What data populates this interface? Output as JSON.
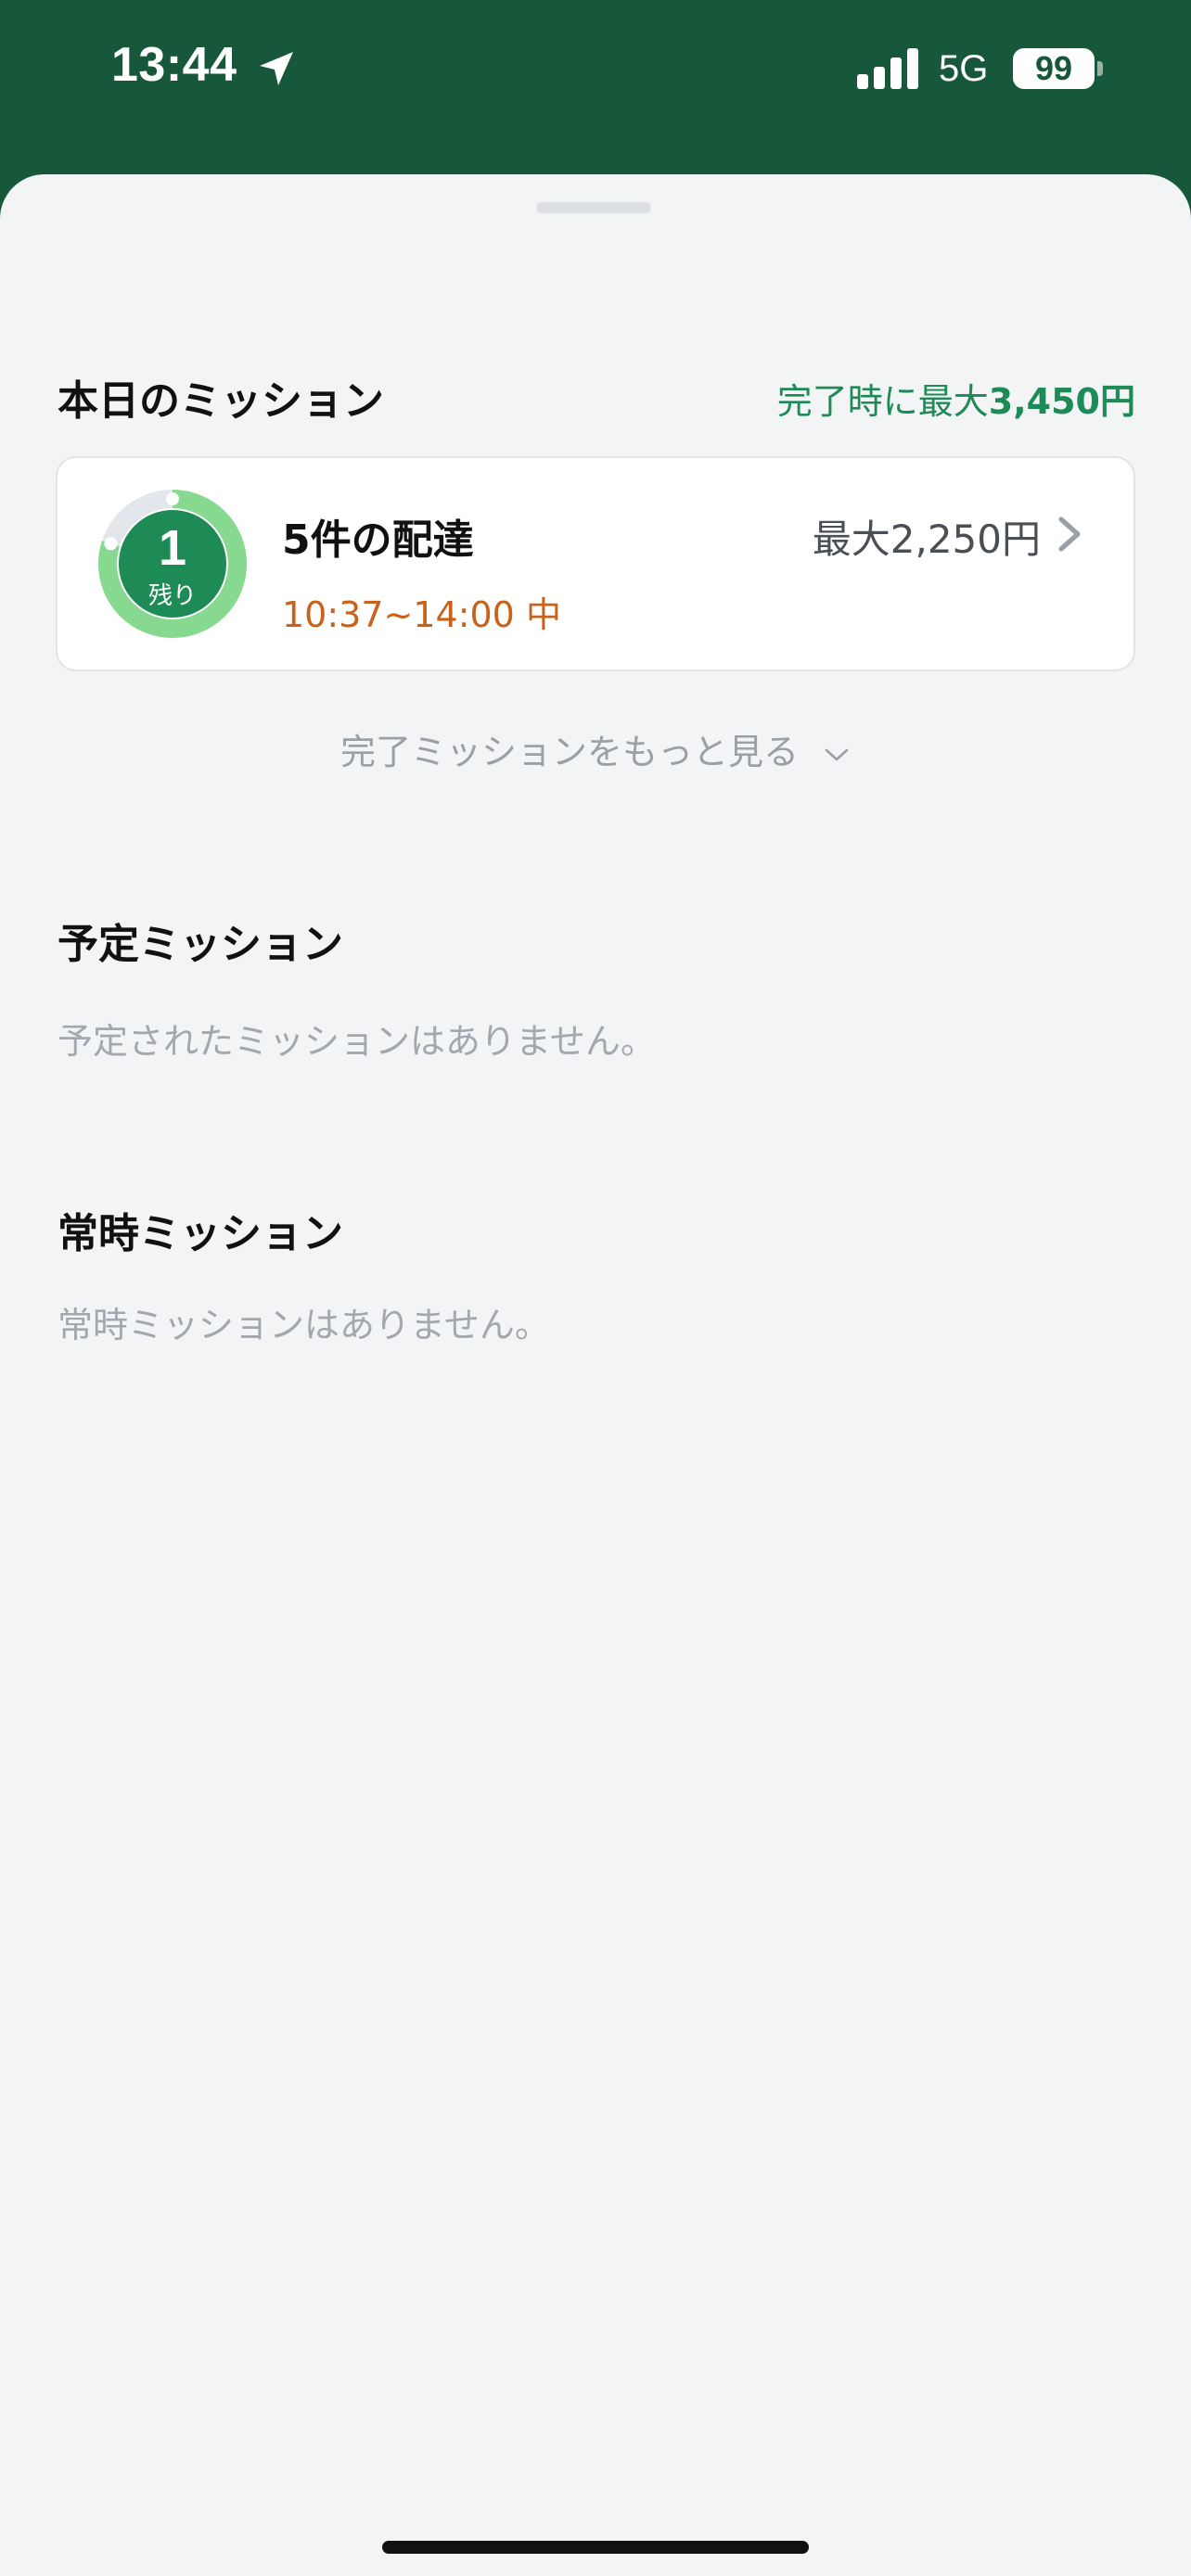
{
  "status_bar": {
    "time": "13:44",
    "network": "5G",
    "battery": "99",
    "icons": [
      "location-arrow-icon",
      "signal-icon",
      "battery-icon"
    ]
  },
  "today": {
    "title": "本日のミッション",
    "reward_prefix": "完了時に最大",
    "reward_amount": "3,450円",
    "reward_color": "#1e8a55",
    "mission": {
      "remaining_number": "1",
      "remaining_label": "残り",
      "title": "5件の配達",
      "time": "10:37~14:00 中",
      "reward": "最大2,250円",
      "progress_fraction": 0.8,
      "ring_color": "#86d98f",
      "center_color": "#1e8a55",
      "time_color": "#c8621a"
    },
    "more_label": "完了ミッションをもっと見る"
  },
  "scheduled": {
    "title": "予定ミッション",
    "empty": "予定されたミッションはありません。"
  },
  "permanent": {
    "title": "常時ミッション",
    "empty": "常時ミッションはありません。"
  }
}
